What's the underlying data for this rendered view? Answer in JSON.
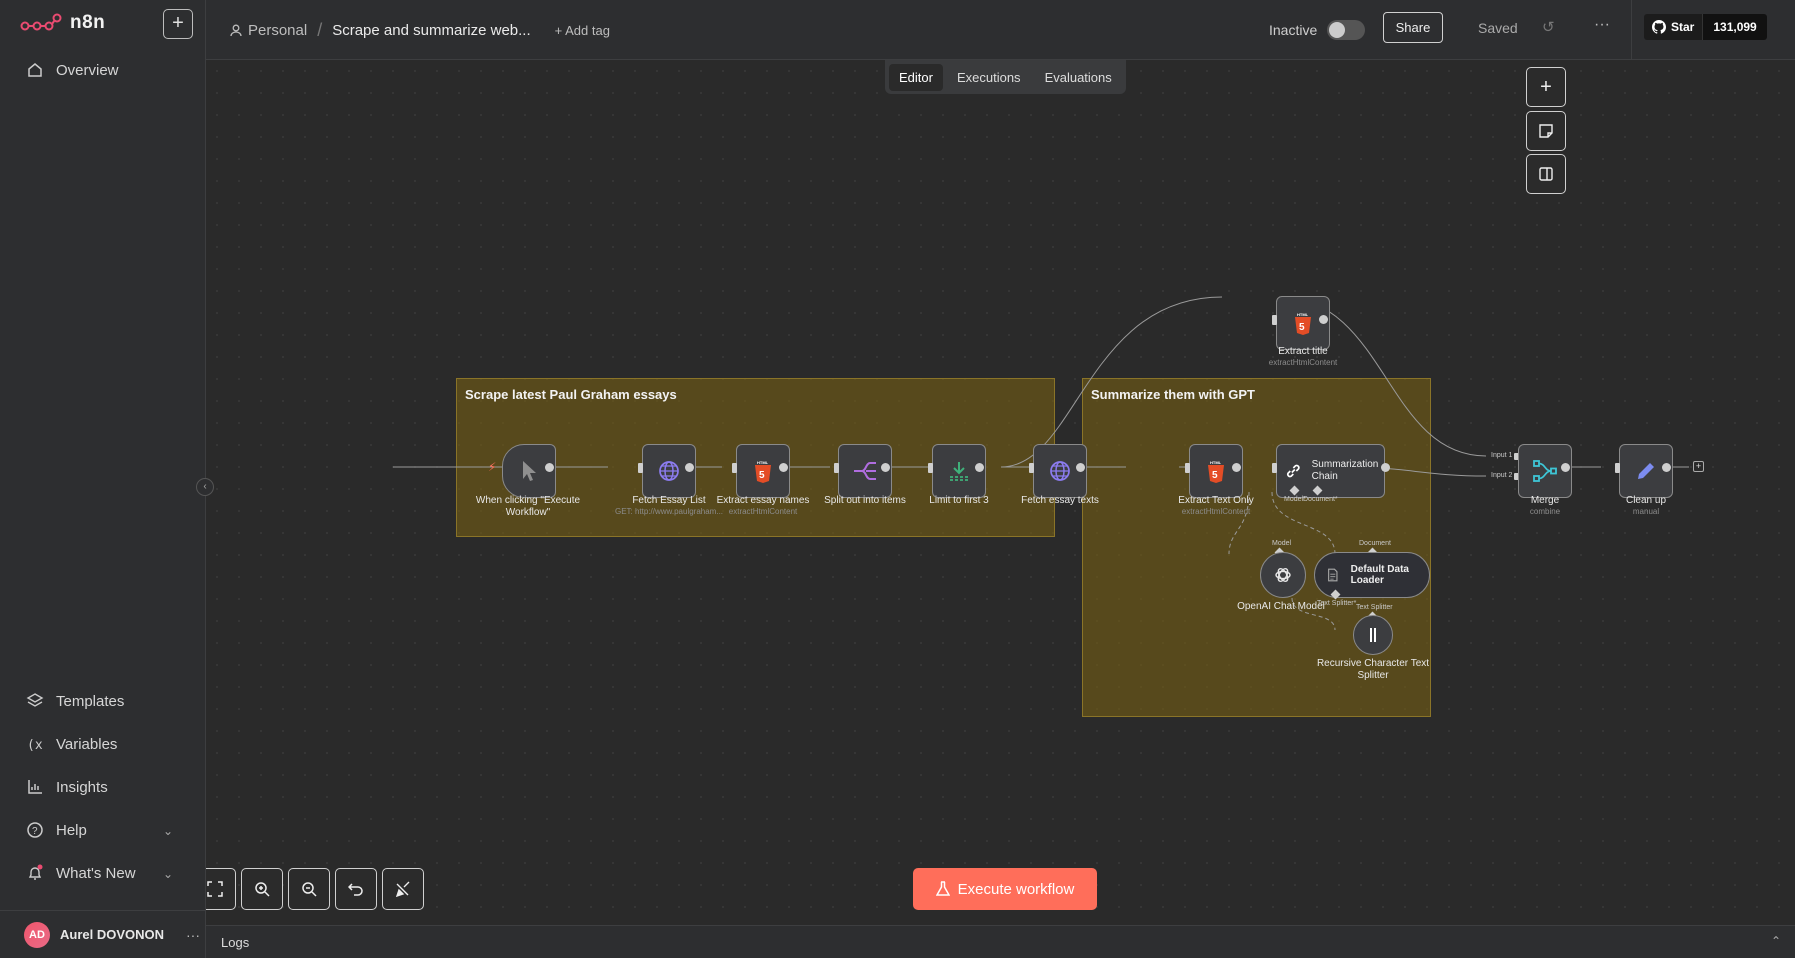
{
  "app": {
    "name": "n8n"
  },
  "sidebar": {
    "overview": "Overview",
    "items": [
      {
        "label": "Templates"
      },
      {
        "label": "Variables"
      },
      {
        "label": "Insights"
      },
      {
        "label": "Help"
      },
      {
        "label": "What's New"
      }
    ],
    "user": {
      "initials": "AD",
      "name": "Aurel DOVONON"
    }
  },
  "header": {
    "project": "Personal",
    "workflow_name": "Scrape and summarize web...",
    "add_tag": "+ Add tag",
    "status": "Inactive",
    "share": "Share",
    "saved": "Saved",
    "github_star": "Star",
    "github_count": "131,099"
  },
  "tabs": [
    {
      "label": "Editor",
      "active": true
    },
    {
      "label": "Executions",
      "active": false
    },
    {
      "label": "Evaluations",
      "active": false
    }
  ],
  "stickies": {
    "scrape": "Scrape latest Paul Graham essays",
    "summarize": "Summarize them with GPT"
  },
  "nodes": {
    "trigger": {
      "label": "When clicking \"Execute Workflow\""
    },
    "fetch_list": {
      "label": "Fetch Essay List",
      "sub": "GET: http://www.paulgraham..."
    },
    "extract_names": {
      "label": "Extract essay names",
      "sub": "extractHtmlContent"
    },
    "split": {
      "label": "Split out into items"
    },
    "limit": {
      "label": "Limit to first 3"
    },
    "fetch_texts": {
      "label": "Fetch essay texts"
    },
    "extract_title": {
      "label": "Extract title",
      "sub": "extractHtmlContent"
    },
    "extract_text": {
      "label": "Extract Text Only",
      "sub": "extractHtmlContent"
    },
    "summarization": {
      "label": "Summarization Chain",
      "port_model": "Model*",
      "port_document": "Document*"
    },
    "openai": {
      "label": "OpenAI Chat Model",
      "port": "Model"
    },
    "loader": {
      "label": "Default Data Loader",
      "port_doc": "Document",
      "port_splitter": "Text Splitter*"
    },
    "splitter": {
      "label": "Recursive Character Text Splitter",
      "port": "Text Splitter"
    },
    "merge": {
      "label": "Merge",
      "sub": "combine",
      "input1": "Input 1",
      "input2": "Input 2"
    },
    "cleanup": {
      "label": "Clean up",
      "sub": "manual"
    }
  },
  "footer": {
    "execute": "Execute workflow",
    "logs": "Logs"
  },
  "colors": {
    "accent": "#ff6e5a",
    "brand": "#ea4b71",
    "sticky": "#735c14"
  }
}
